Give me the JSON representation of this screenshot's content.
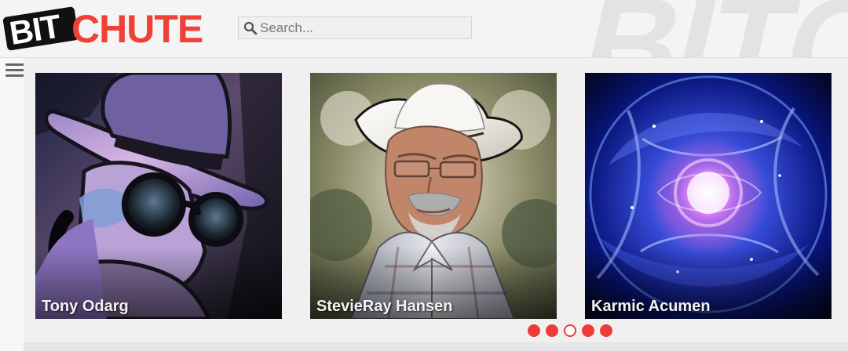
{
  "header": {
    "logo": {
      "bit": "BIT",
      "chute": "CHUTE",
      "watermark": "BITC"
    },
    "search": {
      "placeholder": "Search..."
    }
  },
  "menu": {
    "icon": "hamburger-menu-icon"
  },
  "carousel": {
    "cards": [
      {
        "title": "Tony Odarg",
        "image": "masked-figure-portrait"
      },
      {
        "title": "StevieRay Hansen",
        "image": "man-in-cowboy-hat-portrait"
      },
      {
        "title": "Karmic Acumen",
        "image": "cosmic-galaxy-sphere"
      }
    ],
    "pagination": {
      "active_index": 2,
      "count": 5
    }
  },
  "colors": {
    "brand_red": "#ef3b37",
    "logo_black": "#111111",
    "background": "#efefef"
  }
}
